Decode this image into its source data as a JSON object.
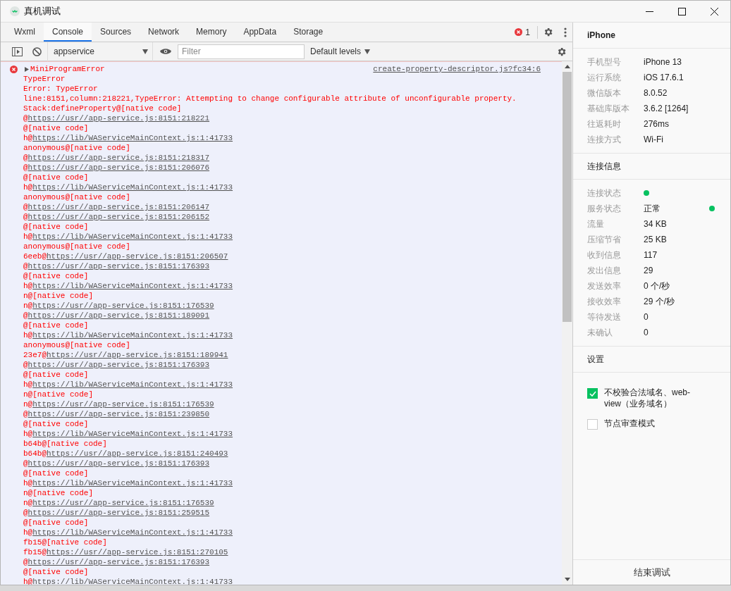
{
  "window": {
    "title": "真机调试"
  },
  "tabs": [
    {
      "label": "Wxml",
      "selected": false
    },
    {
      "label": "Console",
      "selected": true
    },
    {
      "label": "Sources",
      "selected": false
    },
    {
      "label": "Network",
      "selected": false
    },
    {
      "label": "Memory",
      "selected": false
    },
    {
      "label": "AppData",
      "selected": false
    },
    {
      "label": "Storage",
      "selected": false
    }
  ],
  "error_count": "1",
  "toolbar": {
    "context": "appservice",
    "filter": {
      "placeholder": "Filter"
    },
    "levels": "Default levels"
  },
  "message": {
    "title": "MiniProgramError",
    "source": "create-property-descriptor.js?fc34:6",
    "expanded": false,
    "lines": [
      {
        "text": "TypeError"
      },
      {
        "text": "Error: TypeError"
      },
      {
        "text": "line:8151,column:218221,TypeError: Attempting to change configurable attribute of unconfigurable property."
      },
      {
        "text": "Stack:defineProperty@[native code]"
      },
      {
        "text": "@",
        "link": "https://usr//app-service.js:8151:218221"
      },
      {
        "text": "@[native code]"
      },
      {
        "text": "h@",
        "link": "https://lib/WAServiceMainContext.js:1:41733"
      },
      {
        "text": "anonymous@[native code]"
      },
      {
        "text": "@",
        "link": "https://usr//app-service.js:8151:218317"
      },
      {
        "text": "@",
        "link": "https://usr//app-service.js:8151:206076"
      },
      {
        "text": "@[native code]"
      },
      {
        "text": "h@",
        "link": "https://lib/WAServiceMainContext.js:1:41733"
      },
      {
        "text": "anonymous@[native code]"
      },
      {
        "text": "@",
        "link": "https://usr//app-service.js:8151:206147"
      },
      {
        "text": "@",
        "link": "https://usr//app-service.js:8151:206152"
      },
      {
        "text": "@[native code]"
      },
      {
        "text": "h@",
        "link": "https://lib/WAServiceMainContext.js:1:41733"
      },
      {
        "text": "anonymous@[native code]"
      },
      {
        "text": "6eeb@",
        "link": "https://usr//app-service.js:8151:206507"
      },
      {
        "text": "@",
        "link": "https://usr//app-service.js:8151:176393"
      },
      {
        "text": "@[native code]"
      },
      {
        "text": "h@",
        "link": "https://lib/WAServiceMainContext.js:1:41733"
      },
      {
        "text": "n@[native code]"
      },
      {
        "text": "n@",
        "link": "https://usr//app-service.js:8151:176539"
      },
      {
        "text": "@",
        "link": "https://usr//app-service.js:8151:189091"
      },
      {
        "text": "@[native code]"
      },
      {
        "text": "h@",
        "link": "https://lib/WAServiceMainContext.js:1:41733"
      },
      {
        "text": "anonymous@[native code]"
      },
      {
        "text": "23e7@",
        "link": "https://usr//app-service.js:8151:189941"
      },
      {
        "text": "@",
        "link": "https://usr//app-service.js:8151:176393"
      },
      {
        "text": "@[native code]"
      },
      {
        "text": "h@",
        "link": "https://lib/WAServiceMainContext.js:1:41733"
      },
      {
        "text": "n@[native code]"
      },
      {
        "text": "n@",
        "link": "https://usr//app-service.js:8151:176539"
      },
      {
        "text": "@",
        "link": "https://usr//app-service.js:8151:239850"
      },
      {
        "text": "@[native code]"
      },
      {
        "text": "h@",
        "link": "https://lib/WAServiceMainContext.js:1:41733"
      },
      {
        "text": "b64b@[native code]"
      },
      {
        "text": "b64b@",
        "link": "https://usr//app-service.js:8151:240493"
      },
      {
        "text": "@",
        "link": "https://usr//app-service.js:8151:176393"
      },
      {
        "text": "@[native code]"
      },
      {
        "text": "h@",
        "link": "https://lib/WAServiceMainContext.js:1:41733"
      },
      {
        "text": "n@[native code]"
      },
      {
        "text": "n@",
        "link": "https://usr//app-service.js:8151:176539"
      },
      {
        "text": "@",
        "link": "https://usr//app-service.js:8151:259515"
      },
      {
        "text": "@[native code]"
      },
      {
        "text": "h@",
        "link": "https://lib/WAServiceMainContext.js:1:41733"
      },
      {
        "text": "fb15@[native code]"
      },
      {
        "text": "fb15@",
        "link": "https://usr//app-service.js:8151:270105"
      },
      {
        "text": "@",
        "link": "https://usr//app-service.js:8151:176393"
      },
      {
        "text": "@[native code]"
      },
      {
        "text": "h@",
        "link": "https://lib/WAServiceMainContext.js:1:41733"
      }
    ]
  },
  "side_panel": {
    "device": "iPhone",
    "device_info": [
      {
        "label": "手机型号",
        "value": "iPhone 13"
      },
      {
        "label": "运行系统",
        "value": "iOS 17.6.1"
      },
      {
        "label": "微信版本",
        "value": "8.0.52"
      },
      {
        "label": "基础库版本",
        "value": "3.6.2 [1264]"
      },
      {
        "label": "往返耗时",
        "value": "276ms"
      },
      {
        "label": "连接方式",
        "value": "Wi-Fi"
      }
    ],
    "connection_title": "连接信息",
    "connection_info": [
      {
        "label": "连接状态",
        "color": "#07c160"
      },
      {
        "label": "服务状态",
        "value": "正常",
        "color": "#07c160"
      },
      {
        "label": "流量",
        "value": "34 KB"
      },
      {
        "label": "压缩节省",
        "value": "25 KB"
      },
      {
        "label": "收到信息",
        "value": "117"
      },
      {
        "label": "发出信息",
        "value": "29"
      },
      {
        "label": "发送效率",
        "value": "0 个/秒"
      },
      {
        "label": "接收效率",
        "value": "29 个/秒"
      },
      {
        "label": "等待发送",
        "value": "0"
      },
      {
        "label": "未确认",
        "value": "0"
      }
    ],
    "settings_title": "设置",
    "settings": [
      {
        "label": "不校验合法域名、web-view（业务域名）",
        "checked": true
      },
      {
        "label": "节点审查模式",
        "checked": false
      }
    ],
    "end_button": "结束调试"
  }
}
